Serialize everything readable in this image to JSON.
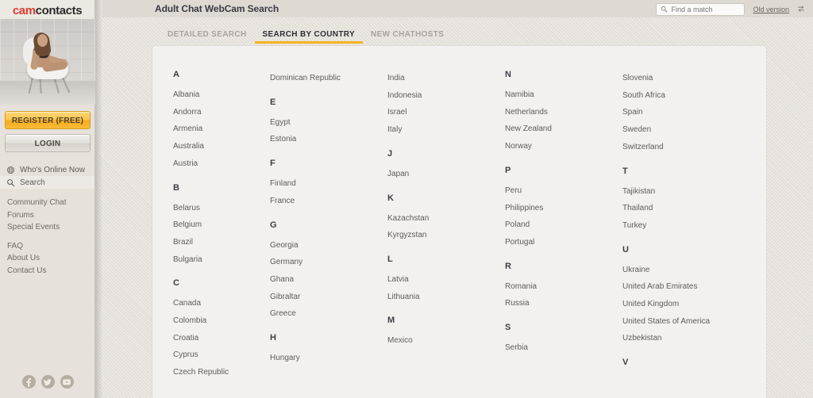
{
  "brand": {
    "part1": "cam",
    "part2": "contacts",
    "color_red": "#e23a2e"
  },
  "sidebar": {
    "register_label": "REGISTER (FREE)",
    "login_label": "LOGIN",
    "primary": [
      {
        "label": "Who's Online Now",
        "icon": "person-globe-icon",
        "active": false
      },
      {
        "label": "Search",
        "icon": "search-icon",
        "active": true
      }
    ],
    "links_group_1": [
      "Community Chat",
      "Forums",
      "Special Events"
    ],
    "links_group_2": [
      "FAQ",
      "About Us",
      "Contact Us"
    ],
    "socials": [
      "facebook-icon",
      "twitter-icon",
      "youtube-icon"
    ]
  },
  "header": {
    "title": "Adult Chat WebCam Search",
    "search": {
      "placeholder": "Find a match",
      "value": "",
      "icon": "search-icon"
    },
    "old_version_label": "Old version",
    "old_version_icon": "swap-arrows-icon"
  },
  "tabs": [
    {
      "label": "DETAILED SEARCH",
      "active": false
    },
    {
      "label": "SEARCH BY COUNTRY",
      "active": true
    },
    {
      "label": "NEW CHATHOSTS",
      "active": false
    }
  ],
  "accent_color": "#f5b322",
  "columns": [
    [
      {
        "letter": "A",
        "countries": [
          "Albania",
          "Andorra",
          "Armenia",
          "Australia",
          "Austria"
        ]
      },
      {
        "letter": "B",
        "countries": [
          "Belarus",
          "Belgium",
          "Brazil",
          "Bulgaria"
        ]
      },
      {
        "letter": "C",
        "countries": [
          "Canada",
          "Colombia",
          "Croatia",
          "Cyprus",
          "Czech Republic"
        ]
      }
    ],
    [
      {
        "letter": "",
        "countries": [
          "Dominican Republic"
        ]
      },
      {
        "letter": "E",
        "countries": [
          "Egypt",
          "Estonia"
        ]
      },
      {
        "letter": "F",
        "countries": [
          "Finland",
          "France"
        ]
      },
      {
        "letter": "G",
        "countries": [
          "Georgia",
          "Germany",
          "Ghana",
          "Gibraltar",
          "Greece"
        ]
      },
      {
        "letter": "H",
        "countries": [
          "Hungary"
        ]
      }
    ],
    [
      {
        "letter": "",
        "countries": [
          "India",
          "Indonesia",
          "Israel",
          "Italy"
        ]
      },
      {
        "letter": "J",
        "countries": [
          "Japan"
        ]
      },
      {
        "letter": "K",
        "countries": [
          "Kazachstan",
          "Kyrgyzstan"
        ]
      },
      {
        "letter": "L",
        "countries": [
          "Latvia",
          "Lithuania"
        ]
      },
      {
        "letter": "M",
        "countries": [
          "Mexico"
        ]
      }
    ],
    [
      {
        "letter": "N",
        "countries": [
          "Namibia",
          "Netherlands",
          "New Zealand",
          "Norway"
        ]
      },
      {
        "letter": "P",
        "countries": [
          "Peru",
          "Philippines",
          "Poland",
          "Portugal"
        ]
      },
      {
        "letter": "R",
        "countries": [
          "Romania",
          "Russia"
        ]
      },
      {
        "letter": "S",
        "countries": [
          "Serbia"
        ]
      }
    ],
    [
      {
        "letter": "",
        "countries": [
          "Slovenia",
          "South Africa",
          "Spain",
          "Sweden",
          "Switzerland"
        ]
      },
      {
        "letter": "T",
        "countries": [
          "Tajikistan",
          "Thailand",
          "Turkey"
        ]
      },
      {
        "letter": "U",
        "countries": [
          "Ukraine",
          "United Arab Emirates",
          "United Kingdom",
          "United States of America",
          "Uzbekistan"
        ]
      },
      {
        "letter": "V",
        "countries": []
      }
    ]
  ]
}
